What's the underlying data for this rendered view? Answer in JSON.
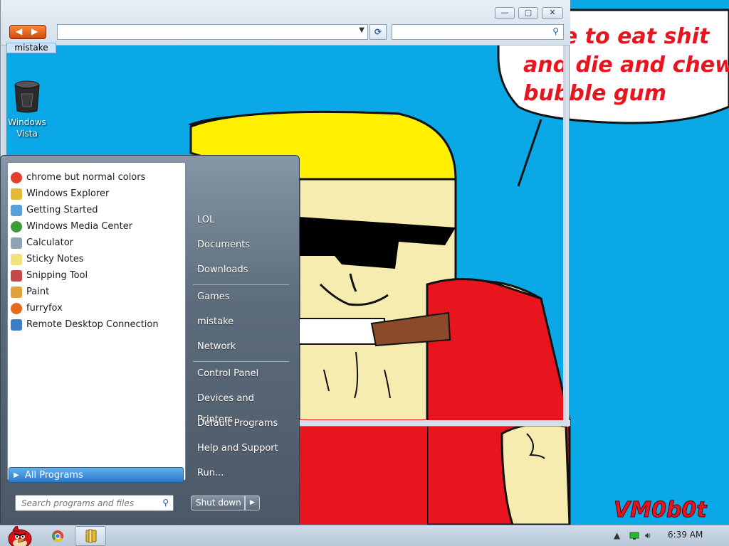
{
  "desktop": {
    "icons": [
      {
        "label_line1": "Windows",
        "label_line2": "Vista",
        "icon": "recycle-bin-icon"
      }
    ],
    "partially_visible_label": "mistake",
    "wallpaper_text": "time to eat shit\nand die and chew\nbubble gum",
    "wallpaper_signature": "VM0b0t"
  },
  "explorer": {
    "address_value": "",
    "search_value": "",
    "caption_buttons": {
      "minimize": "—",
      "maximize": "▢",
      "close": "✕"
    }
  },
  "start_menu": {
    "pinned_programs": [
      {
        "label": "chrome but normal colors",
        "icon": "chrome-icon",
        "color": "#e2402f"
      },
      {
        "label": "Windows Explorer",
        "icon": "folder-icon",
        "color": "#e3b93a"
      },
      {
        "label": "Getting Started",
        "icon": "getting-started-icon",
        "color": "#5aa0d8"
      },
      {
        "label": "Windows Media Center",
        "icon": "media-center-icon",
        "color": "#3f9a3a"
      },
      {
        "label": "Calculator",
        "icon": "calculator-icon",
        "color": "#8fa3b5"
      },
      {
        "label": "Sticky Notes",
        "icon": "sticky-notes-icon",
        "color": "#f2e27a"
      },
      {
        "label": "Snipping Tool",
        "icon": "scissors-icon",
        "color": "#c44a4a"
      },
      {
        "label": "Paint",
        "icon": "paint-icon",
        "color": "#e0a33a"
      },
      {
        "label": "furryfox",
        "icon": "firefox-icon",
        "color": "#e76a1f"
      },
      {
        "label": "Remote Desktop Connection",
        "icon": "remote-desktop-icon",
        "color": "#3d7dc6"
      }
    ],
    "all_programs_label": "All Programs",
    "search_placeholder": "Search programs and files",
    "right_items": [
      {
        "label": "LOL"
      },
      {
        "label": "Documents"
      },
      {
        "label": "Downloads"
      },
      {
        "label": "Games"
      },
      {
        "label": "mistake"
      },
      {
        "label": "Network"
      },
      {
        "label": "Control Panel"
      },
      {
        "label": "Devices and Printers"
      },
      {
        "label": "Default Programs"
      },
      {
        "label": "Help and Support"
      },
      {
        "label": "Run..."
      }
    ],
    "shutdown_label": "Shut down"
  },
  "taskbar": {
    "clock": "6:39 AM",
    "pinned": [
      "angry-bird-start-icon",
      "chrome-icon",
      "explorer-icon"
    ]
  },
  "colors": {
    "wallpaper": "#0aa8e6",
    "meme_text": "#e8141e",
    "all_programs": "#2a79c9"
  }
}
